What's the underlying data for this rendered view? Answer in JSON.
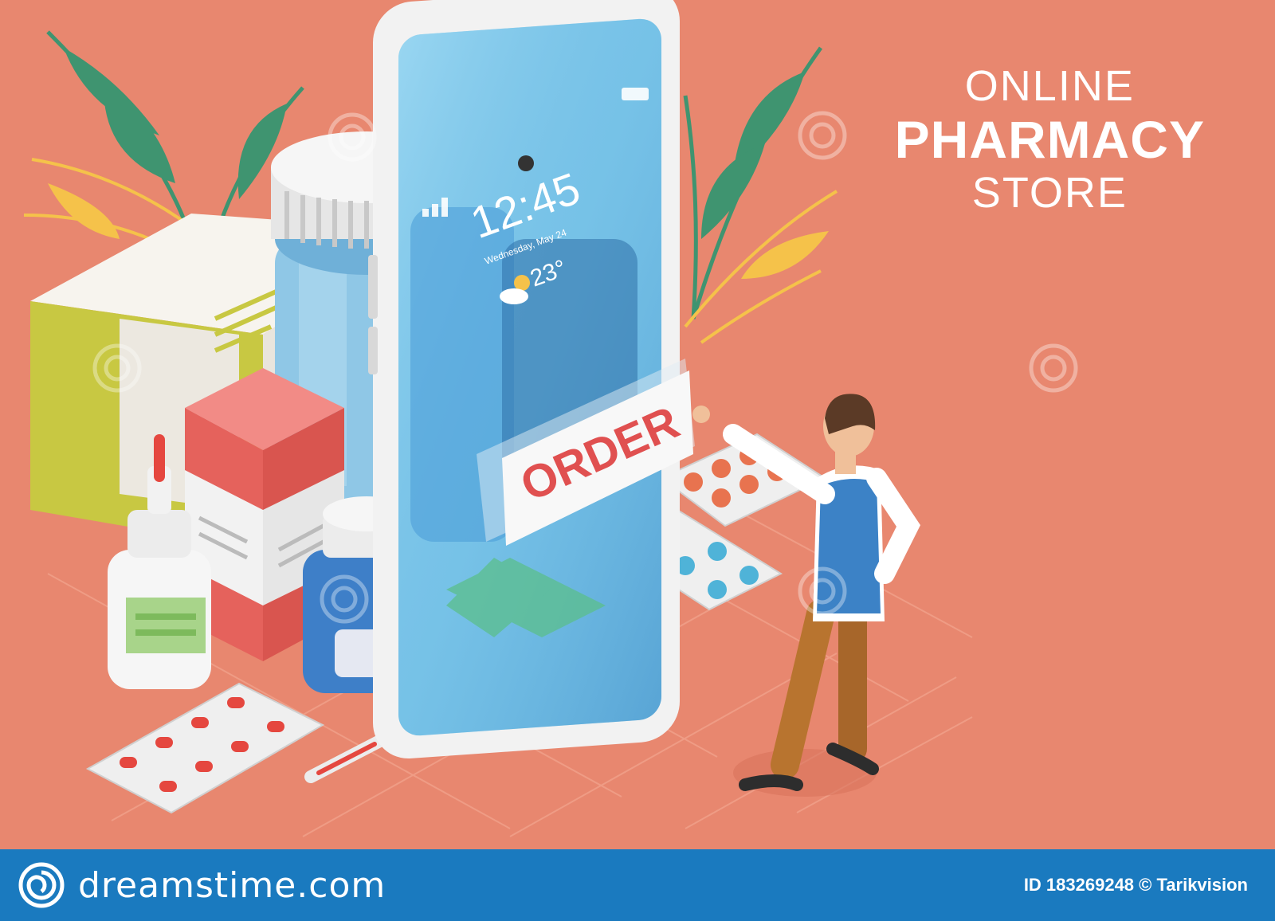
{
  "headline": {
    "line1": "ONLINE",
    "line2": "PHARMACY",
    "line3": "STORE"
  },
  "phone": {
    "time": "12:45",
    "date": "Wednesday, May 24",
    "temperature": "23°",
    "order_label": "ORDER"
  },
  "footer": {
    "brand": "dreamstime.com",
    "credit": "ID 183269248 © Tarikvision"
  },
  "colors": {
    "background": "#e8876f",
    "footer": "#1a7abf",
    "order_text": "#e05050"
  }
}
